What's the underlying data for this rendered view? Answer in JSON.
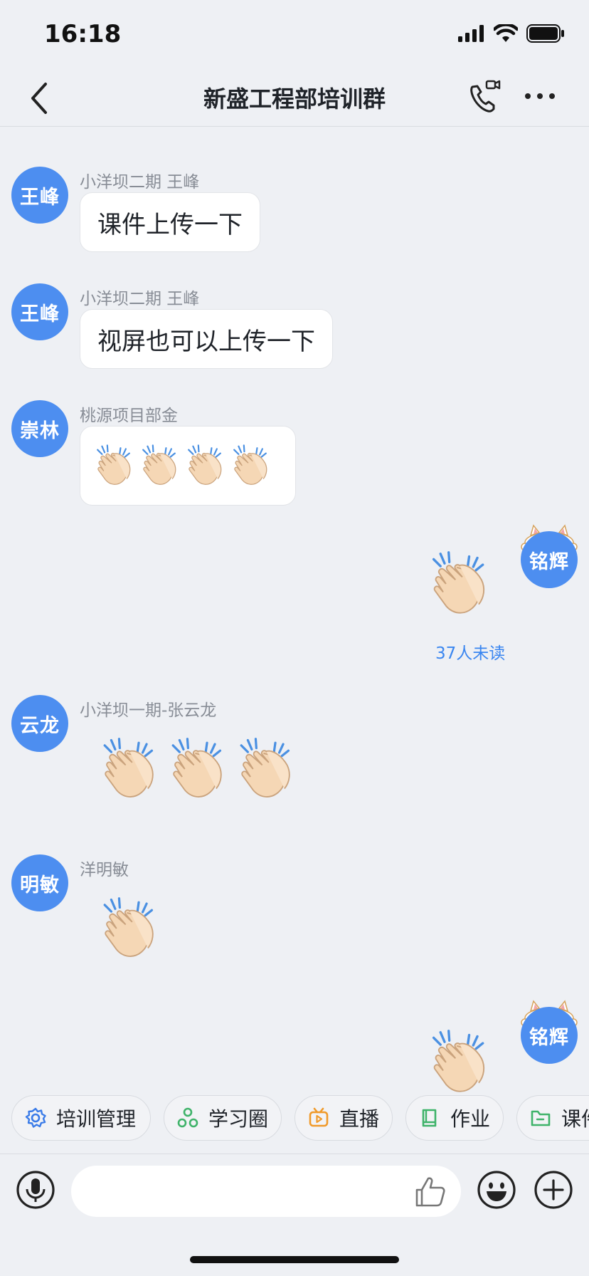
{
  "status": {
    "time": "16:18"
  },
  "header": {
    "title": "新盛工程部培训群"
  },
  "messages": [
    {
      "avatar": "王峰",
      "sender": "小洋坝二期 王峰",
      "text": "课件上传一下"
    },
    {
      "avatar": "王峰",
      "sender": "小洋坝二期 王峰",
      "text": "视屏也可以上传一下"
    },
    {
      "avatar": "崇林",
      "sender": "桃源项目部金",
      "emoji_count": 4
    },
    {
      "avatar": "铭辉",
      "self": true,
      "emoji_count": 1,
      "unread": "37人未读"
    },
    {
      "avatar": "云龙",
      "sender": "小洋坝一期-张云龙",
      "emoji_count": 3
    },
    {
      "avatar": "明敏",
      "sender": "洋明敏",
      "emoji_count": 1
    },
    {
      "avatar": "铭辉",
      "self": true,
      "emoji_count": 1
    }
  ],
  "quick_actions": [
    {
      "label": "培训管理",
      "icon": "gear-icon",
      "color": "#3a7be8"
    },
    {
      "label": "学习圈",
      "icon": "circle-nodes-icon",
      "color": "#3fb36a"
    },
    {
      "label": "直播",
      "icon": "tv-play-icon",
      "color": "#f09a2a"
    },
    {
      "label": "作业",
      "icon": "book-icon",
      "color": "#3fb36a"
    },
    {
      "label": "课件",
      "icon": "folder-icon",
      "color": "#3fb36a"
    }
  ],
  "input": {
    "placeholder": ""
  }
}
